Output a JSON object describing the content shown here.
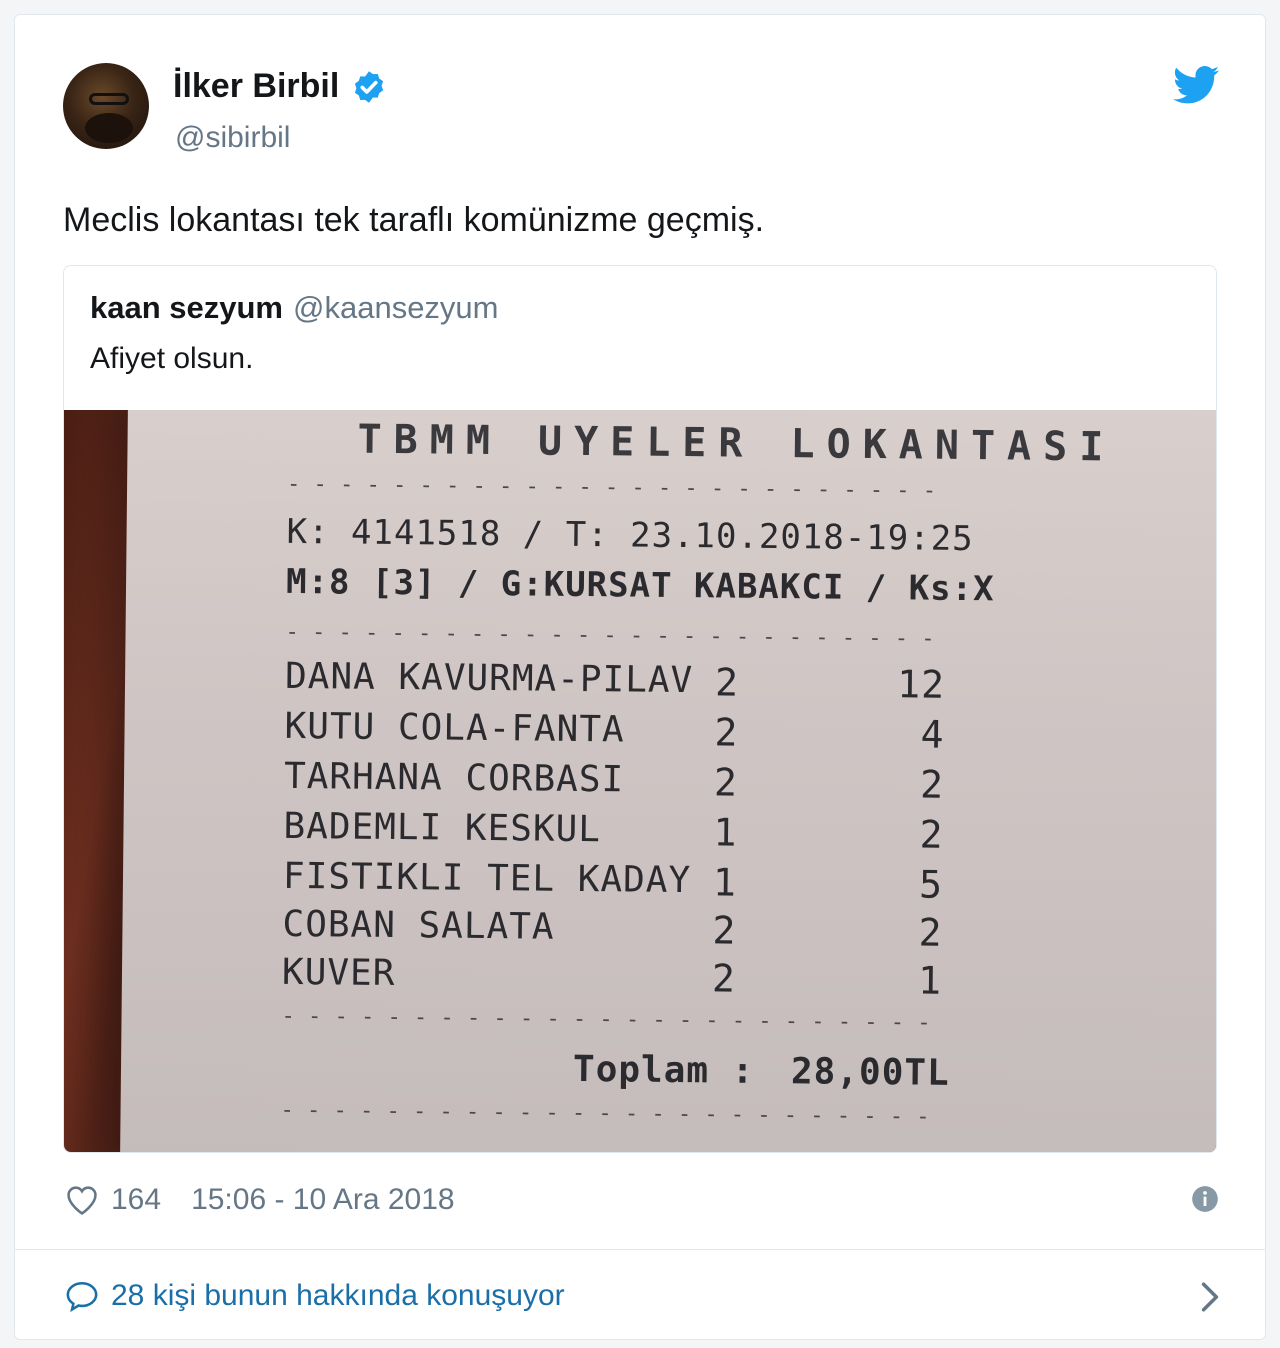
{
  "tweet": {
    "author_name": "İlker Birbil",
    "author_handle": "@sibirbil",
    "text": "Meclis lokantası tek taraflı komünizme geçmiş.",
    "likes": "164",
    "timestamp": "15:06 - 10 Ara 2018",
    "conversation": "28 kişi bunun hakkında konuşuyor"
  },
  "quoted": {
    "name": "kaan sezyum",
    "handle": "@kaansezyum",
    "text": "Afiyet olsun."
  },
  "receipt": {
    "title": "TBMM UYELER LOKANTASI",
    "line1": "K: 4141518 / T: 23.10.2018-19:25",
    "line2": "M:8 [3] / G:KURSAT KABAKCI / Ks:X",
    "items": [
      {
        "name": "DANA KAVURMA-PILAV",
        "qty": "2",
        "price": "12"
      },
      {
        "name": "KUTU COLA-FANTA",
        "qty": "2",
        "price": "4"
      },
      {
        "name": "TARHANA CORBASI",
        "qty": "2",
        "price": "2"
      },
      {
        "name": "BADEMLI KESKUL",
        "qty": "1",
        "price": "2"
      },
      {
        "name": "FISTIKLI TEL KADAY",
        "qty": "1",
        "price": "5"
      },
      {
        "name": "COBAN SALATA",
        "qty": "2",
        "price": "2"
      },
      {
        "name": "KUVER",
        "qty": "2",
        "price": "1"
      }
    ],
    "total_label": "Toplam :",
    "total_value": "28,00TL"
  },
  "colors": {
    "accent": "#1da1f2",
    "link": "#1b6fa8",
    "muted": "#657786"
  },
  "icons": [
    "twitter-bird-icon",
    "verified-badge-icon",
    "heart-icon",
    "info-icon",
    "reply-bubble-icon",
    "chevron-right-icon"
  ]
}
